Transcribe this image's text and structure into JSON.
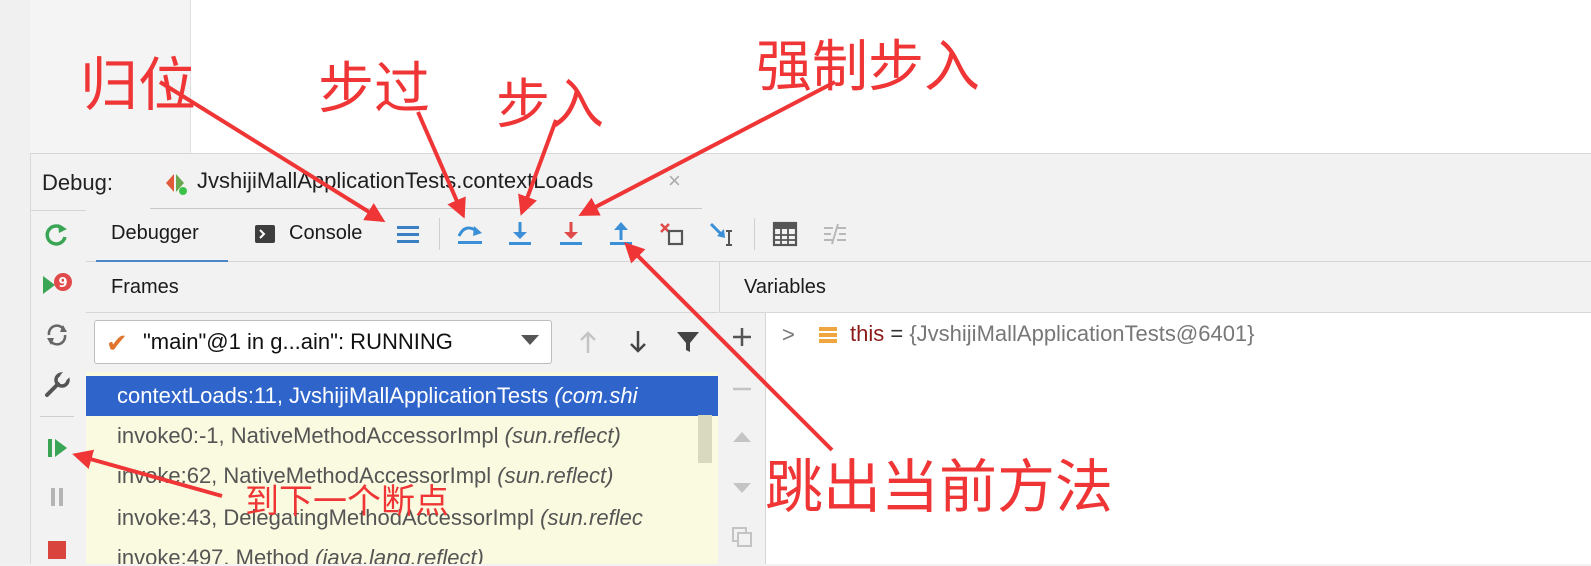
{
  "debug_bar": {
    "label": "Debug:",
    "run_tab": "JvshijiMallApplicationTests.contextLoads",
    "close": "×"
  },
  "toolbar": {
    "tab_debugger": "Debugger",
    "tab_console": "Console"
  },
  "frames": {
    "header": "Frames",
    "thread_check": "✔",
    "thread": "\"main\"@1 in g...ain\": RUNNING",
    "rows": [
      {
        "method": "contextLoads:11, JvshijiMallApplicationTests ",
        "pkg": "(com.shi"
      },
      {
        "method": "invoke0:-1, NativeMethodAccessorImpl ",
        "pkg": "(sun.reflect)"
      },
      {
        "method": "invoke:62, NativeMethodAccessorImpl ",
        "pkg": "(sun.reflect)"
      },
      {
        "method": "invoke:43, DelegatingMethodAccessorImpl ",
        "pkg": "(sun.reflec"
      },
      {
        "method": "invoke:497, Method ",
        "pkg": "(java.lang.reflect)"
      }
    ]
  },
  "variables": {
    "header": "Variables",
    "expand": ">",
    "name": "this",
    "eq": " = ",
    "value": "{JvshijiMallApplicationTests@6401}"
  },
  "annotations": {
    "return_position": "归位",
    "step_over": "步过",
    "step_into": "步入",
    "force_step_into": "强制步入",
    "step_out": "跳出当前方法",
    "resume": "到下一个断点"
  },
  "colors": {
    "annotation": "#ef3535",
    "selection": "#2f65ca",
    "frames_bg": "#fafae0",
    "step_icon_blue": "#3b8fd6",
    "step_icon_red": "#e04a4a"
  },
  "icons": {
    "side": [
      "rerun-icon",
      "resume-numbered-icon",
      "reload-icon",
      "settings-wrench-icon",
      "resume-program-icon",
      "pause-icon",
      "stop-icon"
    ],
    "toolbar": [
      "show-execution-point-icon",
      "step-over-icon",
      "step-into-icon",
      "force-step-into-icon",
      "step-out-icon",
      "drop-frame-icon",
      "run-to-cursor-icon",
      "evaluate-expression-icon",
      "trace-current-stream-icon"
    ]
  }
}
